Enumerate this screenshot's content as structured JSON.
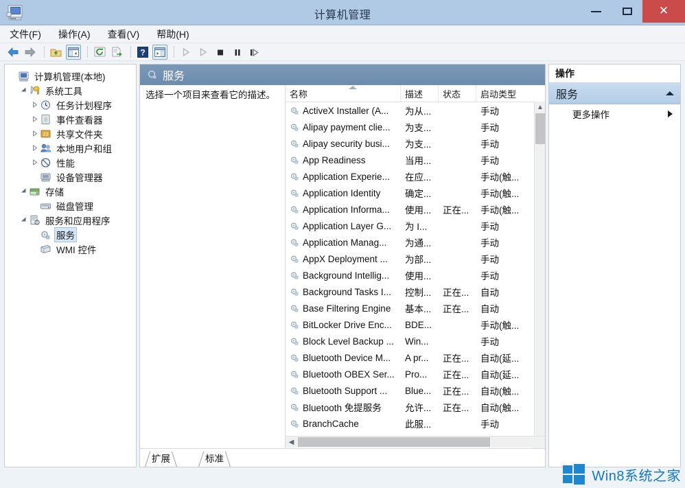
{
  "window": {
    "title": "计算机管理",
    "app_icon": "computer-management-icon",
    "controls": {
      "minimize": "–",
      "maximize": "□",
      "close": "✕"
    }
  },
  "menubar": {
    "items": [
      {
        "label": "文件(F)",
        "text": "文件",
        "accel": "F"
      },
      {
        "label": "操作(A)",
        "text": "操作",
        "accel": "A"
      },
      {
        "label": "查看(V)",
        "text": "查看",
        "accel": "V"
      },
      {
        "label": "帮助(H)",
        "text": "帮助",
        "accel": "H"
      }
    ]
  },
  "toolbar": {
    "buttons": [
      {
        "name": "back-icon",
        "enabled": true
      },
      {
        "name": "forward-icon",
        "enabled": true
      },
      {
        "name": "up-folder-icon",
        "enabled": true
      },
      {
        "name": "show-hide-tree-icon",
        "enabled": true,
        "pressed": true
      },
      {
        "name": "refresh-icon",
        "enabled": true
      },
      {
        "name": "export-list-icon",
        "enabled": true
      },
      {
        "name": "help-icon",
        "enabled": true
      },
      {
        "name": "show-action-pane-icon",
        "enabled": true,
        "pressed": true
      },
      {
        "name": "start-service-icon",
        "enabled": false
      },
      {
        "name": "restart-service-icon",
        "enabled": false
      },
      {
        "name": "stop-service-icon",
        "enabled": false
      },
      {
        "name": "pause-service-icon",
        "enabled": false
      },
      {
        "name": "resume-service-icon",
        "enabled": false
      }
    ]
  },
  "tree": {
    "nodes": [
      {
        "label": "计算机管理(本地)",
        "icon": "computer-icon",
        "indent": 0,
        "expander": "",
        "selected": false
      },
      {
        "label": "系统工具",
        "icon": "tools-icon",
        "indent": 1,
        "expander": "▲",
        "selected": false
      },
      {
        "label": "任务计划程序",
        "icon": "clock-icon",
        "indent": 2,
        "expander": "▷",
        "selected": false
      },
      {
        "label": "事件查看器",
        "icon": "event-viewer-icon",
        "indent": 2,
        "expander": "▷",
        "selected": false
      },
      {
        "label": "共享文件夹",
        "icon": "shared-folder-icon",
        "indent": 2,
        "expander": "▷",
        "selected": false
      },
      {
        "label": "本地用户和组",
        "icon": "users-groups-icon",
        "indent": 2,
        "expander": "▷",
        "selected": false
      },
      {
        "label": "性能",
        "icon": "performance-icon",
        "indent": 2,
        "expander": "▷",
        "selected": false
      },
      {
        "label": "设备管理器",
        "icon": "device-manager-icon",
        "indent": 2,
        "expander": "",
        "selected": false
      },
      {
        "label": "存储",
        "icon": "storage-icon",
        "indent": 1,
        "expander": "▲",
        "selected": false
      },
      {
        "label": "磁盘管理",
        "icon": "disk-management-icon",
        "indent": 2,
        "expander": "",
        "selected": false
      },
      {
        "label": "服务和应用程序",
        "icon": "services-apps-icon",
        "indent": 1,
        "expander": "▲",
        "selected": false
      },
      {
        "label": "服务",
        "icon": "service-gear-icon",
        "indent": 2,
        "expander": "",
        "selected": true
      },
      {
        "label": "WMI 控件",
        "icon": "wmi-control-icon",
        "indent": 2,
        "expander": "",
        "selected": false
      }
    ]
  },
  "center": {
    "header_title": "服务",
    "header_icon": "service-gear-icon",
    "description": "选择一个项目来查看它的描述。",
    "columns": [
      {
        "key": "name",
        "label": "名称",
        "sorted": "asc"
      },
      {
        "key": "desc",
        "label": "描述",
        "sorted": ""
      },
      {
        "key": "state",
        "label": "状态",
        "sorted": ""
      },
      {
        "key": "start",
        "label": "启动类型",
        "sorted": ""
      }
    ],
    "rows": [
      {
        "name": "ActiveX Installer (A...",
        "desc": "为从...",
        "state": "",
        "start": "手动"
      },
      {
        "name": "Alipay payment clie...",
        "desc": "为支...",
        "state": "",
        "start": "手动"
      },
      {
        "name": "Alipay security busi...",
        "desc": "为支...",
        "state": "",
        "start": "手动"
      },
      {
        "name": "App Readiness",
        "desc": "当用...",
        "state": "",
        "start": "手动"
      },
      {
        "name": "Application Experie...",
        "desc": "在应...",
        "state": "",
        "start": "手动(触..."
      },
      {
        "name": "Application Identity",
        "desc": "确定...",
        "state": "",
        "start": "手动(触..."
      },
      {
        "name": "Application Informa...",
        "desc": "使用...",
        "state": "正在...",
        "start": "手动(触..."
      },
      {
        "name": "Application Layer G...",
        "desc": "为 I...",
        "state": "",
        "start": "手动"
      },
      {
        "name": "Application Manag...",
        "desc": "为通...",
        "state": "",
        "start": "手动"
      },
      {
        "name": "AppX Deployment ...",
        "desc": "为部...",
        "state": "",
        "start": "手动"
      },
      {
        "name": "Background Intellig...",
        "desc": "使用...",
        "state": "",
        "start": "手动"
      },
      {
        "name": "Background Tasks I...",
        "desc": "控制...",
        "state": "正在...",
        "start": "自动"
      },
      {
        "name": "Base Filtering Engine",
        "desc": "基本...",
        "state": "正在...",
        "start": "自动"
      },
      {
        "name": "BitLocker Drive Enc...",
        "desc": "BDE...",
        "state": "",
        "start": "手动(触..."
      },
      {
        "name": "Block Level Backup ...",
        "desc": "Win...",
        "state": "",
        "start": "手动"
      },
      {
        "name": "Bluetooth Device M...",
        "desc": "A pr...",
        "state": "正在...",
        "start": "自动(延..."
      },
      {
        "name": "Bluetooth OBEX Ser...",
        "desc": "Pro...",
        "state": "正在...",
        "start": "自动(延..."
      },
      {
        "name": "Bluetooth Support ...",
        "desc": "Blue...",
        "state": "正在...",
        "start": "自动(触..."
      },
      {
        "name": "Bluetooth 免提服务",
        "desc": "允许...",
        "state": "正在...",
        "start": "自动(触..."
      },
      {
        "name": "BranchCache",
        "desc": "此服...",
        "state": "",
        "start": "手动"
      }
    ],
    "tabs": [
      {
        "label": "扩展",
        "active": false
      },
      {
        "label": "标准",
        "active": true
      }
    ]
  },
  "actions": {
    "title": "操作",
    "section_label": "服务",
    "section_chevron": "chevron-up-icon",
    "items": [
      {
        "label": "更多操作",
        "submenu_arrow": "arrow-right-icon"
      }
    ]
  },
  "watermark": {
    "text": "Win8系统之家",
    "logo": "windows-logo-icon"
  },
  "colors": {
    "titlebar": "#b0c9e4",
    "close_button": "#cb4a4a",
    "pane_header": "#6d8cad",
    "actions_section": "#b4cde6",
    "selection": "#d4e6f7",
    "watermark_blue": "#1577c8"
  }
}
